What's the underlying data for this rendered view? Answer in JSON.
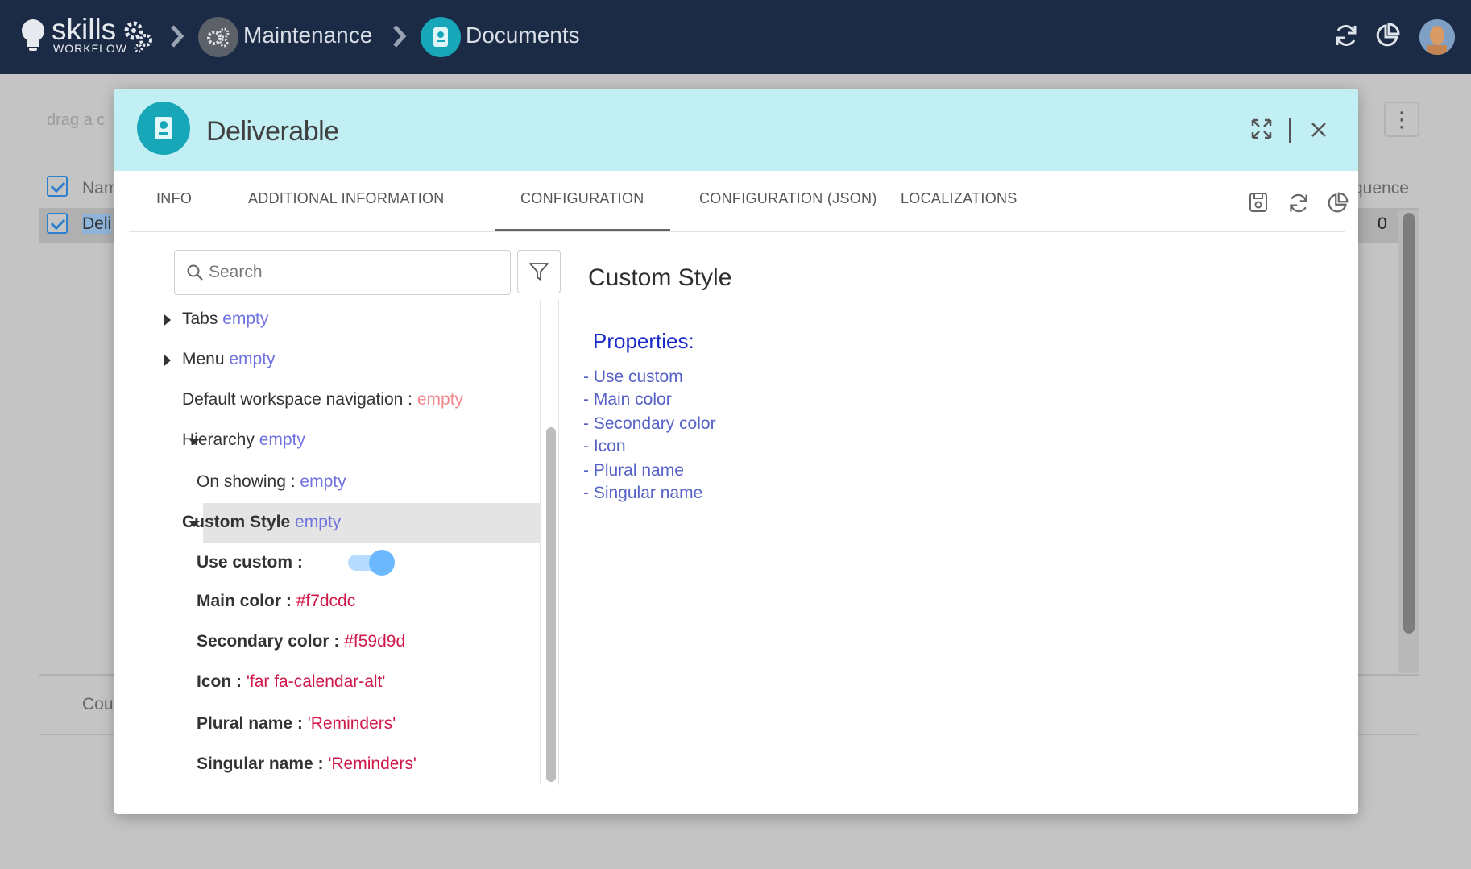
{
  "app": {
    "logo_text": "skills",
    "logo_sub": "WORKFLOW"
  },
  "breadcrumb": [
    {
      "label": "Maintenance",
      "icon": "gears-icon",
      "color": "#6b6f77"
    },
    {
      "label": "Documents",
      "icon": "document-icon",
      "color": "#17a7b8"
    }
  ],
  "background_page": {
    "drag_hint": "drag a c",
    "col_name": "Nam",
    "row_name": "Deli",
    "col_sequence": "quence",
    "row_sequence": "0",
    "footer_label": "Cou"
  },
  "modal": {
    "title": "Deliverable",
    "header_color": "#c1eff3",
    "icon_color": "#17a7b8",
    "tabs": [
      {
        "label": "INFO"
      },
      {
        "label": "ADDITIONAL INFORMATION"
      },
      {
        "label": "CONFIGURATION",
        "active": true
      },
      {
        "label": "CONFIGURATION (JSON)"
      },
      {
        "label": "LOCALIZATIONS"
      }
    ],
    "search_placeholder": "Search"
  },
  "tree": {
    "tabs": {
      "key": "Tabs",
      "value": "empty"
    },
    "menu": {
      "key": "Menu",
      "value": "empty"
    },
    "default_nav": {
      "key": "Default workspace navigation :",
      "value": "empty"
    },
    "hierarchy": {
      "key": "Hierarchy",
      "value": "empty"
    },
    "on_showing": {
      "key": "On showing :",
      "value": "empty"
    },
    "custom_style": {
      "key": "Custom Style",
      "value": "empty"
    },
    "use_custom": {
      "key": "Use custom :",
      "value": true
    },
    "main_color": {
      "key": "Main color :",
      "value": "#f7dcdc"
    },
    "secondary_color": {
      "key": "Secondary color :",
      "value": "#f59d9d"
    },
    "icon": {
      "key": "Icon :",
      "value": "'far fa-calendar-alt'"
    },
    "plural_name": {
      "key": "Plural name :",
      "value": "'Reminders'"
    },
    "singular_name": {
      "key": "Singular name :",
      "value": "'Reminders'"
    }
  },
  "detail": {
    "title": "Custom Style",
    "properties_title": "Properties:",
    "properties": [
      "- Use custom",
      "- Main color",
      "- Secondary color",
      "- Icon",
      "- Plural name",
      "- Singular name"
    ]
  }
}
